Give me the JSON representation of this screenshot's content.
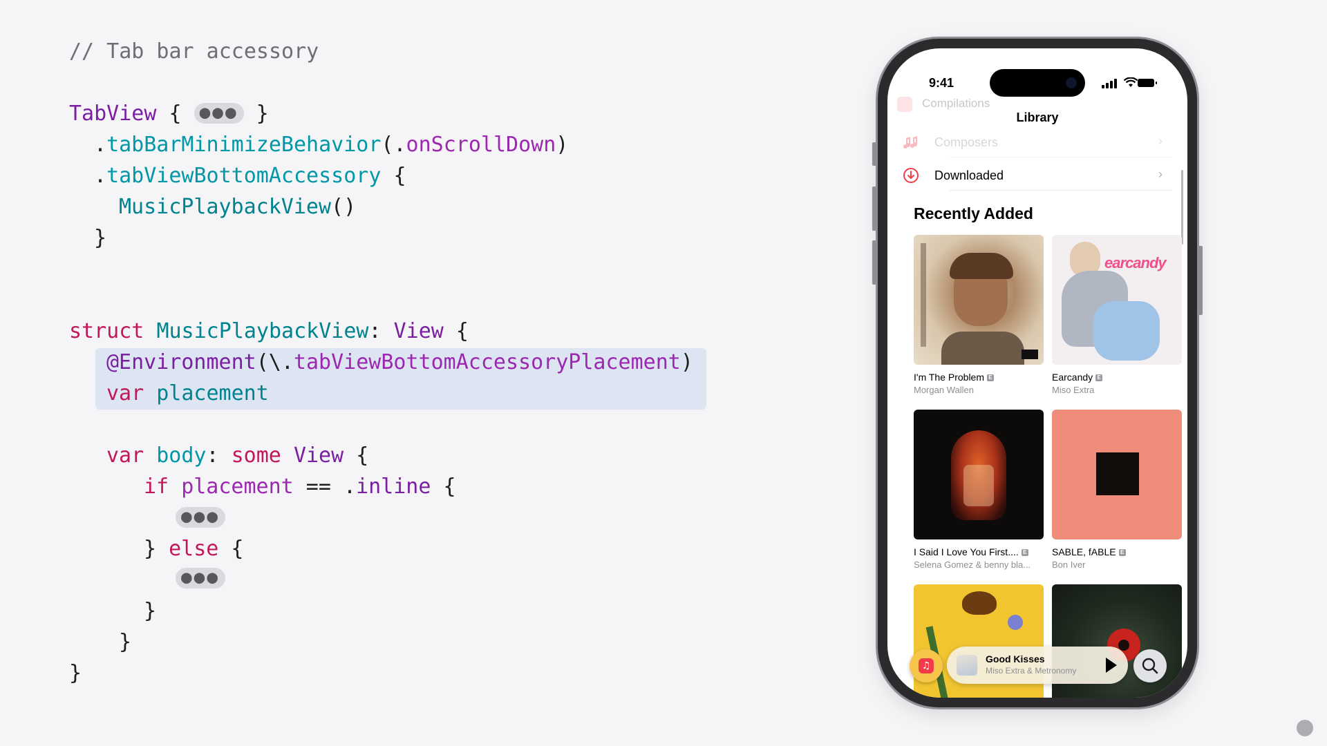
{
  "code": {
    "comment": "// Tab bar accessory",
    "line1": {
      "type": "TabView",
      "open": " {",
      "close": " }"
    },
    "line2": {
      "dot": ".",
      "method": "tabBarMinimizeBehavior",
      "paren_open": "(.",
      "arg": "onScrollDown",
      "paren_close": ")"
    },
    "line3": {
      "dot": ".",
      "method": "tabViewBottomAccessory",
      "brace": " {"
    },
    "line4": {
      "type": "MusicPlaybackView",
      "parens": "()"
    },
    "line5": {
      "brace": "}"
    },
    "line6": {
      "kw": "struct",
      "type": "MusicPlaybackView",
      "colon": ": ",
      "proto": "View",
      "brace": " {"
    },
    "line7": {
      "attr": "@Environment",
      "open": "(\\.",
      "key": "tabViewBottomAccessoryPlacement",
      "close": ")"
    },
    "line8": {
      "kw": "var",
      "name": "placement"
    },
    "line9": {
      "kw": "var",
      "name": "body",
      "colon": ": ",
      "some": "some",
      "type": "View",
      "brace": " {"
    },
    "line10": {
      "kw": "if",
      "name": "placement",
      "op": " == .",
      "case": "inline",
      "brace": " {"
    },
    "line12": {
      "close": "} ",
      "kw": "else",
      "brace": " {"
    },
    "line14": {
      "brace": "}"
    },
    "line15": {
      "brace": "}"
    },
    "line16": {
      "brace": "}"
    },
    "dots": "●●●"
  },
  "phone": {
    "time": "9:41",
    "faded_row": "Compilations",
    "nav_title": "Library",
    "rows": [
      {
        "label": "Composers",
        "icon": "music-notes-icon"
      },
      {
        "label": "Downloaded",
        "icon": "download-circle-icon"
      }
    ],
    "chevron": "›",
    "section_title": "Recently Added",
    "albums": [
      {
        "title": "I'm The Problem",
        "artist": "Morgan Wallen",
        "explicit": "E",
        "art_text": ""
      },
      {
        "title": "Earcandy",
        "artist": "Miso Extra",
        "explicit": "E",
        "art_text": "earcandy"
      },
      {
        "title": "I Said I Love You First....",
        "artist": "Selena Gomez & benny bla...",
        "explicit": "E",
        "art_text": ""
      },
      {
        "title": "SABLE, fABLE",
        "artist": "Bon Iver",
        "explicit": "E",
        "art_text": ""
      }
    ],
    "mini_player": {
      "title": "Good Kisses",
      "artist": "Miso Extra & Metronomy",
      "play_icon": "play-icon"
    },
    "tab_music_icon": "♫",
    "tab_search_icon": "search-icon"
  },
  "colors": {
    "background": "#f5f5f7",
    "keyword": "#c2185b",
    "type": "#7b1fa2",
    "function": "#0097a7",
    "highlight": "#dde5f3",
    "accent_red": "#f23b4a"
  }
}
